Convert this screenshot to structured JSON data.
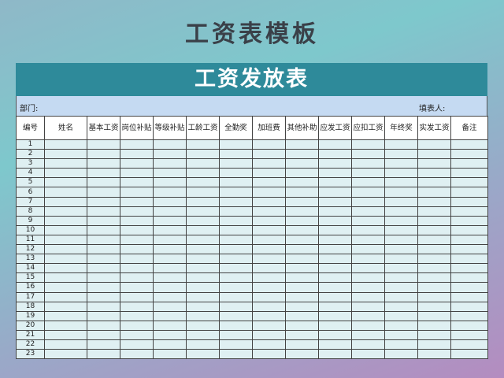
{
  "page_title": "工资表模板",
  "sheet": {
    "title": "工资发放表",
    "dept_label": "部门:",
    "filler_label": "填表人:",
    "columns": [
      "编号",
      "姓名",
      "基本工资",
      "岗位补贴",
      "等级补贴",
      "工龄工资",
      "全勤奖",
      "加班费",
      "其他补助",
      "应发工资",
      "应扣工资",
      "年终奖",
      "实发工资",
      "备注"
    ],
    "rows": [
      "1",
      "2",
      "3",
      "4",
      "5",
      "6",
      "7",
      "8",
      "9",
      "10",
      "11",
      "12",
      "13",
      "14",
      "15",
      "16",
      "17",
      "18",
      "19",
      "20",
      "21",
      "22",
      "23"
    ]
  },
  "colors": {
    "banner": "#2e8a9a",
    "info_bar": "#c5daf2",
    "cell_fill": "#dff0f2"
  }
}
